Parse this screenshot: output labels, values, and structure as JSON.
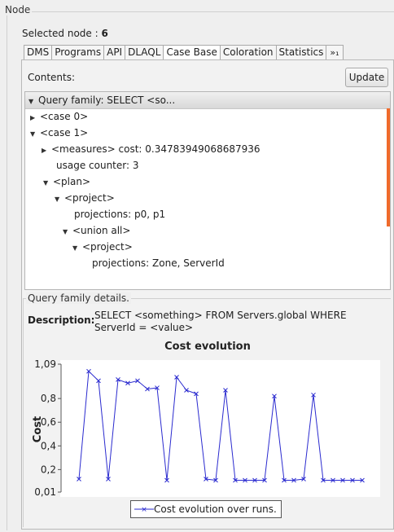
{
  "group_title": "Node",
  "selected_node": {
    "label": "Selected node :",
    "value": "6"
  },
  "tabs": [
    {
      "label": "DMS",
      "active": false
    },
    {
      "label": "Programs",
      "active": false
    },
    {
      "label": "API",
      "active": false
    },
    {
      "label": "DLAQL",
      "active": false
    },
    {
      "label": "Case Base",
      "active": true
    },
    {
      "label": "Coloration",
      "active": false
    },
    {
      "label": "Statistics",
      "active": false
    }
  ],
  "tabs_more": "»₁",
  "contents_label": "Contents:",
  "update_button": "Update",
  "tree": {
    "header": "Query family: SELECT <so...",
    "rows": [
      {
        "text": "<case 0>",
        "arrow": "▶"
      },
      {
        "text": "<case 1>",
        "arrow": "▼"
      },
      {
        "text": "<measures> cost: 0.34783949068687936",
        "arrow": "▶"
      },
      {
        "text": "usage counter: 3",
        "arrow": ""
      },
      {
        "text": "<plan>",
        "arrow": "▼"
      },
      {
        "text": "<project>",
        "arrow": "▼"
      },
      {
        "text": "projections: p0, p1",
        "arrow": ""
      },
      {
        "text": "<union all>",
        "arrow": "▼"
      },
      {
        "text": "<project>",
        "arrow": "▼"
      },
      {
        "text": "projections: Zone, ServerId",
        "arrow": ""
      }
    ]
  },
  "details": {
    "title": "Query family details.",
    "description_label": "Description:",
    "description_line1": "SELECT <something> FROM Servers.global WHERE",
    "description_line2": "ServerId = <value>"
  },
  "colors": {
    "series": "#2a2acf",
    "scroll_accent": "#f06a2a"
  },
  "chart_data": {
    "type": "line",
    "title": "Cost evolution",
    "ylabel": "Cost",
    "xlabel": "",
    "ylim": [
      0.01,
      1.09
    ],
    "yticks": [
      "1,09",
      "0,8",
      "0,6",
      "0,4",
      "0,2",
      "0,01"
    ],
    "ytick_values": [
      1.09,
      0.8,
      0.6,
      0.4,
      0.2,
      0.01
    ],
    "series": [
      {
        "name": "Cost evolution over runs.",
        "values": [
          0.12,
          1.03,
          0.95,
          0.12,
          0.96,
          0.93,
          0.95,
          0.88,
          0.89,
          0.11,
          0.98,
          0.87,
          0.84,
          0.12,
          0.11,
          0.87,
          0.11,
          0.11,
          0.11,
          0.11,
          0.82,
          0.11,
          0.11,
          0.12,
          0.83,
          0.11,
          0.11,
          0.11,
          0.11,
          0.11
        ]
      }
    ],
    "legend": "bottom",
    "grid": false
  }
}
